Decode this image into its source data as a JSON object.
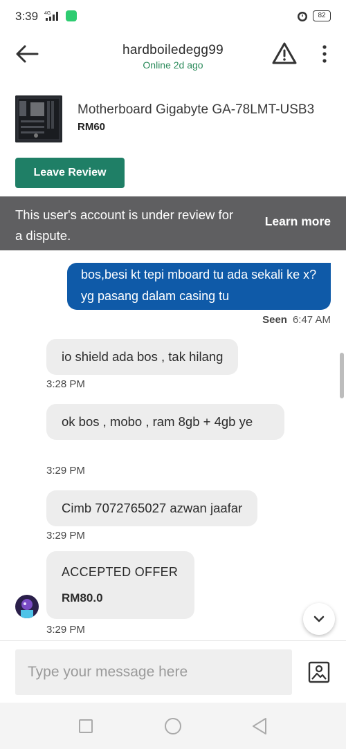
{
  "status_bar": {
    "time": "3:39",
    "network": "4G",
    "battery": "82"
  },
  "header": {
    "username": "hardboiledegg99",
    "online_status": "Online 2d ago"
  },
  "product": {
    "title": "Motherboard Gigabyte GA-78LMT-USB3",
    "price": "RM60"
  },
  "leave_review_label": "Leave Review",
  "dispute_banner": {
    "text": "This user's account is under review for a dispute.",
    "link_label": "Learn more"
  },
  "messages": {
    "outgoing": {
      "text": "bos,besi kt tepi mboard tu ada sekali ke x? yg pasang dalam casing tu",
      "seen_label": "Seen",
      "time": "6:47 AM"
    },
    "incoming": [
      {
        "text": "io shield ada bos , tak hilang",
        "time": "3:28 PM"
      },
      {
        "text": "ok bos , mobo , ram 8gb + 4gb ye",
        "time": "3:29 PM"
      },
      {
        "text": "Cimb 7072765027 azwan jaafar",
        "time": "3:29 PM"
      }
    ],
    "offer": {
      "title": "ACCEPTED OFFER",
      "price": "RM80.0",
      "time": "3:29 PM"
    }
  },
  "composer": {
    "placeholder": "Type your message here"
  },
  "colors": {
    "accent_green": "#1f7f66",
    "online_green": "#2a8a5a",
    "outgoing_bubble": "#0f5aa8",
    "incoming_bubble": "#ededed",
    "banner_bg": "#5f5f61"
  }
}
